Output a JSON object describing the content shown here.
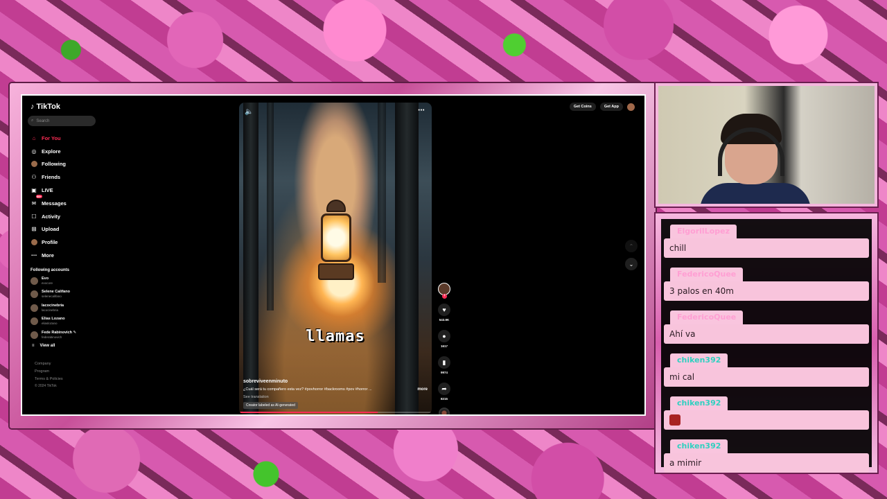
{
  "tiktok": {
    "logo": "TikTok",
    "search_placeholder": "Search",
    "nav": [
      {
        "label": "For You",
        "icon": "home-icon",
        "active": true
      },
      {
        "label": "Explore",
        "icon": "compass-icon"
      },
      {
        "label": "Following",
        "icon": "following-avatar-icon"
      },
      {
        "label": "Friends",
        "icon": "friends-icon"
      },
      {
        "label": "LIVE",
        "icon": "live-icon"
      },
      {
        "label": "Messages",
        "icon": "messages-icon"
      },
      {
        "label": "Activity",
        "icon": "activity-icon"
      },
      {
        "label": "Upload",
        "icon": "upload-icon"
      },
      {
        "label": "Profile",
        "icon": "profile-avatar-icon"
      },
      {
        "label": "More",
        "icon": "more-icon"
      }
    ],
    "following_title": "Following accounts",
    "accounts": [
      {
        "name": "Evo",
        "handle": "evocore"
      },
      {
        "name": "Selene Califano",
        "handle": "selenecalifano"
      },
      {
        "name": "lacocinebria",
        "handle": "lacocinebria"
      },
      {
        "name": "Elias Lozano",
        "handle": "eliaslozano"
      },
      {
        "name": "Fede Rabinovich ✎",
        "handle": "federabinovich"
      }
    ],
    "view_all": "View all",
    "footer": [
      "Company",
      "Program",
      "Terms & Policies"
    ],
    "copyright": "© 2024 TikTok",
    "header": {
      "coins": "Get Coins",
      "app": "Get App"
    },
    "video": {
      "overlay_text": "llamas",
      "author": "sobreviveenminuto",
      "description": "¿Cuál será tu compañero esta vez? #povhorror #backrooms #pov #horror ...",
      "more": "more",
      "see_translation": "See translation",
      "ai_label": "Creator labeled as AI-generated",
      "progress": 0.72
    },
    "actions": {
      "likes": "543.9K",
      "comments": "1617",
      "saves": "9974",
      "shares": "8215"
    }
  },
  "chat": [
    {
      "user": "ElgorilLopez",
      "color": "pink",
      "text": "chill"
    },
    {
      "user": "FedericoQuee",
      "color": "pink",
      "text": "3 palos en 40m"
    },
    {
      "user": "FedericoQuee",
      "color": "pink",
      "text": "Ahí va"
    },
    {
      "user": "chiken392",
      "color": "teal",
      "text": "mi cal"
    },
    {
      "user": "chiken392",
      "color": "teal",
      "text": "",
      "emote": true
    },
    {
      "user": "chiken392",
      "color": "teal",
      "text": "a mimir"
    }
  ],
  "colors": {
    "accent": "#fe2c55",
    "chat_bubble": "#f8c4dc",
    "frame_pink": "#f4b6dd"
  }
}
